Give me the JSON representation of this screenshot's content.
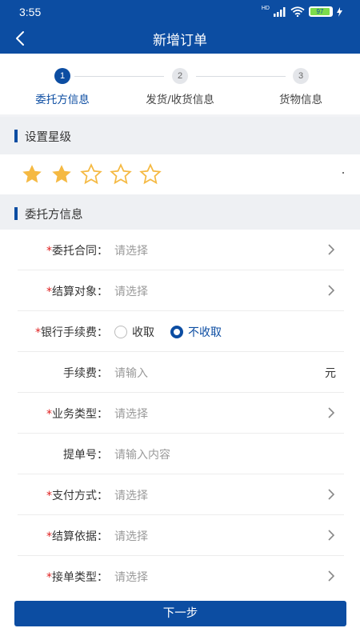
{
  "status_bar": {
    "time": "3:55",
    "network": "HD",
    "battery": "97",
    "icons": [
      "signal-icon",
      "wifi-icon",
      "battery-icon",
      "charging-icon"
    ]
  },
  "nav": {
    "title": "新增订单",
    "back_icon": "back-chevron-icon"
  },
  "steps": [
    {
      "number": "1",
      "label": "委托方信息",
      "active": true
    },
    {
      "number": "2",
      "label": "发货/收货信息",
      "active": false
    },
    {
      "number": "3",
      "label": "货物信息",
      "active": false
    }
  ],
  "rating_section": {
    "title": "设置星级",
    "stars_total": 5,
    "stars_filled": 2
  },
  "client_section": {
    "title": "委托方信息"
  },
  "form": {
    "contract": {
      "required": "*",
      "label": "委托合同：",
      "placeholder": "请选择"
    },
    "settlement_target": {
      "required": "*",
      "label": "结算对象：",
      "placeholder": "请选择"
    },
    "bank_fee": {
      "required": "*",
      "label": "银行手续费：",
      "options": [
        "收取",
        "不收取"
      ],
      "selected": "不收取"
    },
    "fee": {
      "label": "手续费：",
      "placeholder": "请输入",
      "unit": "元"
    },
    "business_type": {
      "required": "*",
      "label": "业务类型：",
      "placeholder": "请选择"
    },
    "bill_no": {
      "label": "提单号：",
      "placeholder": "请输入内容"
    },
    "payment_method": {
      "required": "*",
      "label": "支付方式：",
      "placeholder": "请选择"
    },
    "settlement_basis": {
      "required": "*",
      "label": "结算依据：",
      "placeholder": "请选择"
    },
    "order_type": {
      "required": "*",
      "label": "接单类型：",
      "placeholder": "请选择"
    }
  },
  "footer": {
    "next_label": "下一步"
  },
  "colors": {
    "primary": "#0c4da2",
    "star": "#f5b942",
    "required": "#e02020"
  }
}
